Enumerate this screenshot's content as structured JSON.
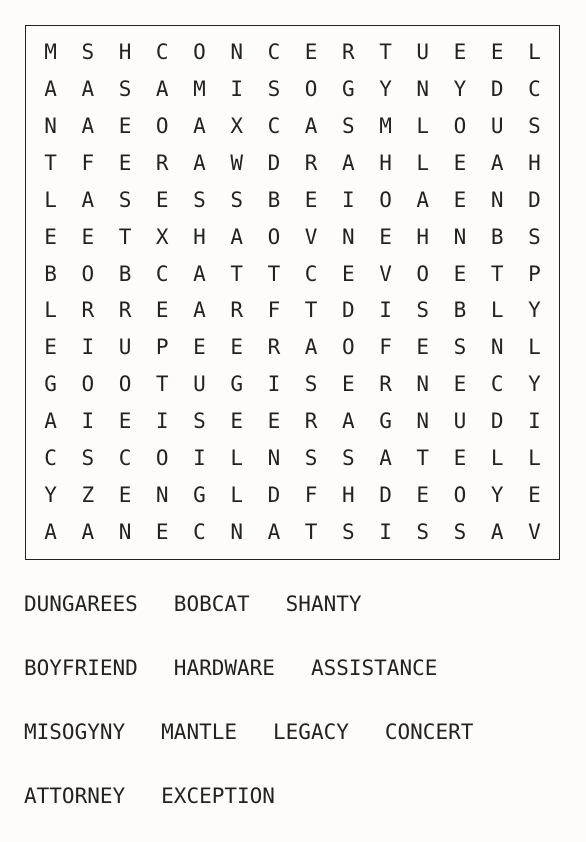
{
  "grid": [
    [
      "M",
      "S",
      "H",
      "C",
      "O",
      "N",
      "C",
      "E",
      "R",
      "T",
      "U",
      "E",
      "E",
      "L"
    ],
    [
      "A",
      "A",
      "S",
      "A",
      "M",
      "I",
      "S",
      "O",
      "G",
      "Y",
      "N",
      "Y",
      "D",
      "C"
    ],
    [
      "N",
      "A",
      "E",
      "O",
      "A",
      "X",
      "C",
      "A",
      "S",
      "M",
      "L",
      "O",
      "U",
      "S"
    ],
    [
      "T",
      "F",
      "E",
      "R",
      "A",
      "W",
      "D",
      "R",
      "A",
      "H",
      "L",
      "E",
      "A",
      "H"
    ],
    [
      "L",
      "A",
      "S",
      "E",
      "S",
      "S",
      "B",
      "E",
      "I",
      "O",
      "A",
      "E",
      "N",
      "D"
    ],
    [
      "E",
      "E",
      "T",
      "X",
      "H",
      "A",
      "O",
      "V",
      "N",
      "E",
      "H",
      "N",
      "B",
      "S"
    ],
    [
      "B",
      "O",
      "B",
      "C",
      "A",
      "T",
      "T",
      "C",
      "E",
      "V",
      "O",
      "E",
      "T",
      "P"
    ],
    [
      "L",
      "R",
      "R",
      "E",
      "A",
      "R",
      "F",
      "T",
      "D",
      "I",
      "S",
      "B",
      "L",
      "Y"
    ],
    [
      "E",
      "I",
      "U",
      "P",
      "E",
      "E",
      "R",
      "A",
      "O",
      "F",
      "E",
      "S",
      "N",
      "L"
    ],
    [
      "G",
      "O",
      "O",
      "T",
      "U",
      "G",
      "I",
      "S",
      "E",
      "R",
      "N",
      "E",
      "C",
      "Y"
    ],
    [
      "A",
      "I",
      "E",
      "I",
      "S",
      "E",
      "E",
      "R",
      "A",
      "G",
      "N",
      "U",
      "D",
      "I"
    ],
    [
      "C",
      "S",
      "C",
      "O",
      "I",
      "L",
      "N",
      "S",
      "S",
      "A",
      "T",
      "E",
      "L",
      "L"
    ],
    [
      "Y",
      "Z",
      "E",
      "N",
      "G",
      "L",
      "D",
      "F",
      "H",
      "D",
      "E",
      "O",
      "Y",
      "E"
    ],
    [
      "A",
      "A",
      "N",
      "E",
      "C",
      "N",
      "A",
      "T",
      "S",
      "I",
      "S",
      "S",
      "A",
      "V"
    ]
  ],
  "word_rows": [
    [
      "DUNGAREES",
      "BOBCAT",
      "SHANTY"
    ],
    [
      "BOYFRIEND",
      "HARDWARE",
      "ASSISTANCE"
    ],
    [
      "MISOGYNY",
      "MANTLE",
      "LEGACY",
      "CONCERT"
    ],
    [
      "ATTORNEY",
      "EXCEPTION"
    ]
  ]
}
